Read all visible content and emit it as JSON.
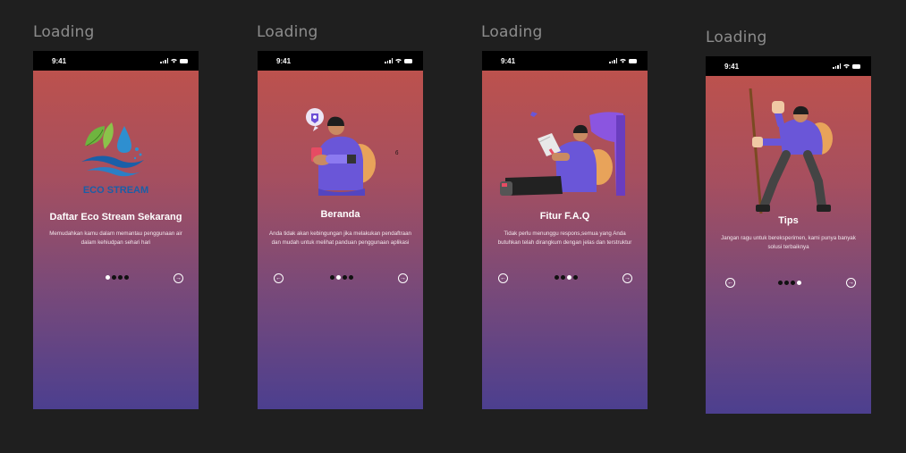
{
  "frames": [
    {
      "label": "Loading",
      "status_time": "9:41",
      "logo_text": "ECO STREAM",
      "title": "Daftar Eco Stream Sekarang",
      "description": "Memudahkan kamu dalam memantau penggunaan air dalam kehiudpan sehari hari",
      "active_dot": 0,
      "next_icon": "arrow-right-circle-icon"
    },
    {
      "label": "Loading",
      "status_time": "9:41",
      "title": "Beranda",
      "description": "Anda tidak akan kebingungan jika melakukan pendaftraan dan mudah untuk melihat panduan penggunaan  aplikasi",
      "active_dot": 1,
      "prev_icon": "arrow-left-circle-icon",
      "next_icon": "arrow-right-circle-icon"
    },
    {
      "label": "Loading",
      "status_time": "9:41",
      "title": "Fitur F.A.Q",
      "description": "Tidak perlu menunggu respons,semua yang Anda butuhkan telah dirangkum dengan jelas dan terstruktur",
      "active_dot": 2,
      "prev_icon": "arrow-left-circle-icon",
      "next_icon": "arrow-right-circle-icon"
    },
    {
      "label": "Loading",
      "status_time": "9:41",
      "title": "Tips",
      "description": "Jangan ragu untuk bereksperimen, kami punya banyak solusi terbaiknya",
      "active_dot": 3,
      "prev_icon": "arrow-left-circle-icon",
      "next_icon": "arrow-right-circle-icon"
    }
  ],
  "colors": {
    "gradient_top": "#c0524a",
    "gradient_bottom": "#4c3f8f",
    "canvas": "#1f1f1f"
  }
}
